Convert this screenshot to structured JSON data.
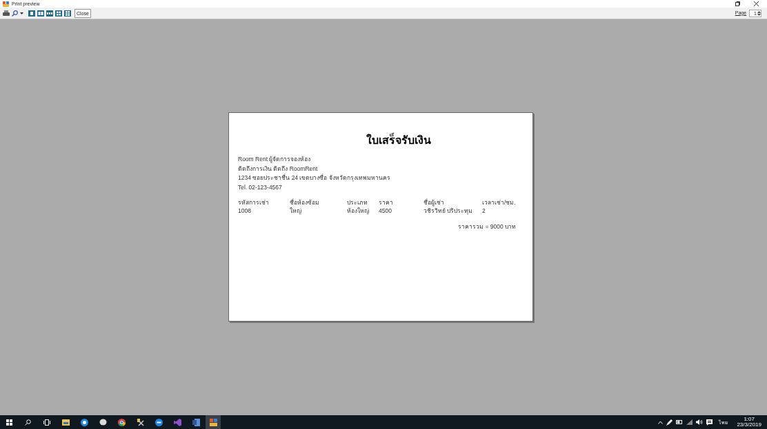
{
  "window": {
    "title": "Print preview"
  },
  "toolbar": {
    "close_button": "Close",
    "page_label": "Page",
    "page_value": "1"
  },
  "receipt": {
    "title": "ใบเสร็จรับเงิน",
    "address_lines": [
      "Room Rent ผู้จัดการจองห้อง",
      "ติดถึงการเงิน ติดถึง RoomRent",
      "1234 ซอยประชาชื่น 24 เขตบางซื่อ จังหวัดกรุงเทพมหานคร",
      "Tel. 02-123-4567"
    ],
    "table": {
      "columns": [
        "รหัสการเช่า",
        "ชื่อห้องซ้อม",
        "ประเภท",
        "ราคา",
        "ชื่อผู้เช่า",
        "เวลาเช่า/ชม."
      ],
      "rows": [
        [
          "1008",
          "ใหญ่",
          "ห้องใหญ่",
          "4500",
          "วชิรวิทย์ ปริประทุม",
          "2"
        ]
      ]
    },
    "total": "ราคารวม = 9000 บาท"
  },
  "taskbar": {
    "language": "ไทย",
    "time": "1:07",
    "date": "23/3/2019"
  }
}
